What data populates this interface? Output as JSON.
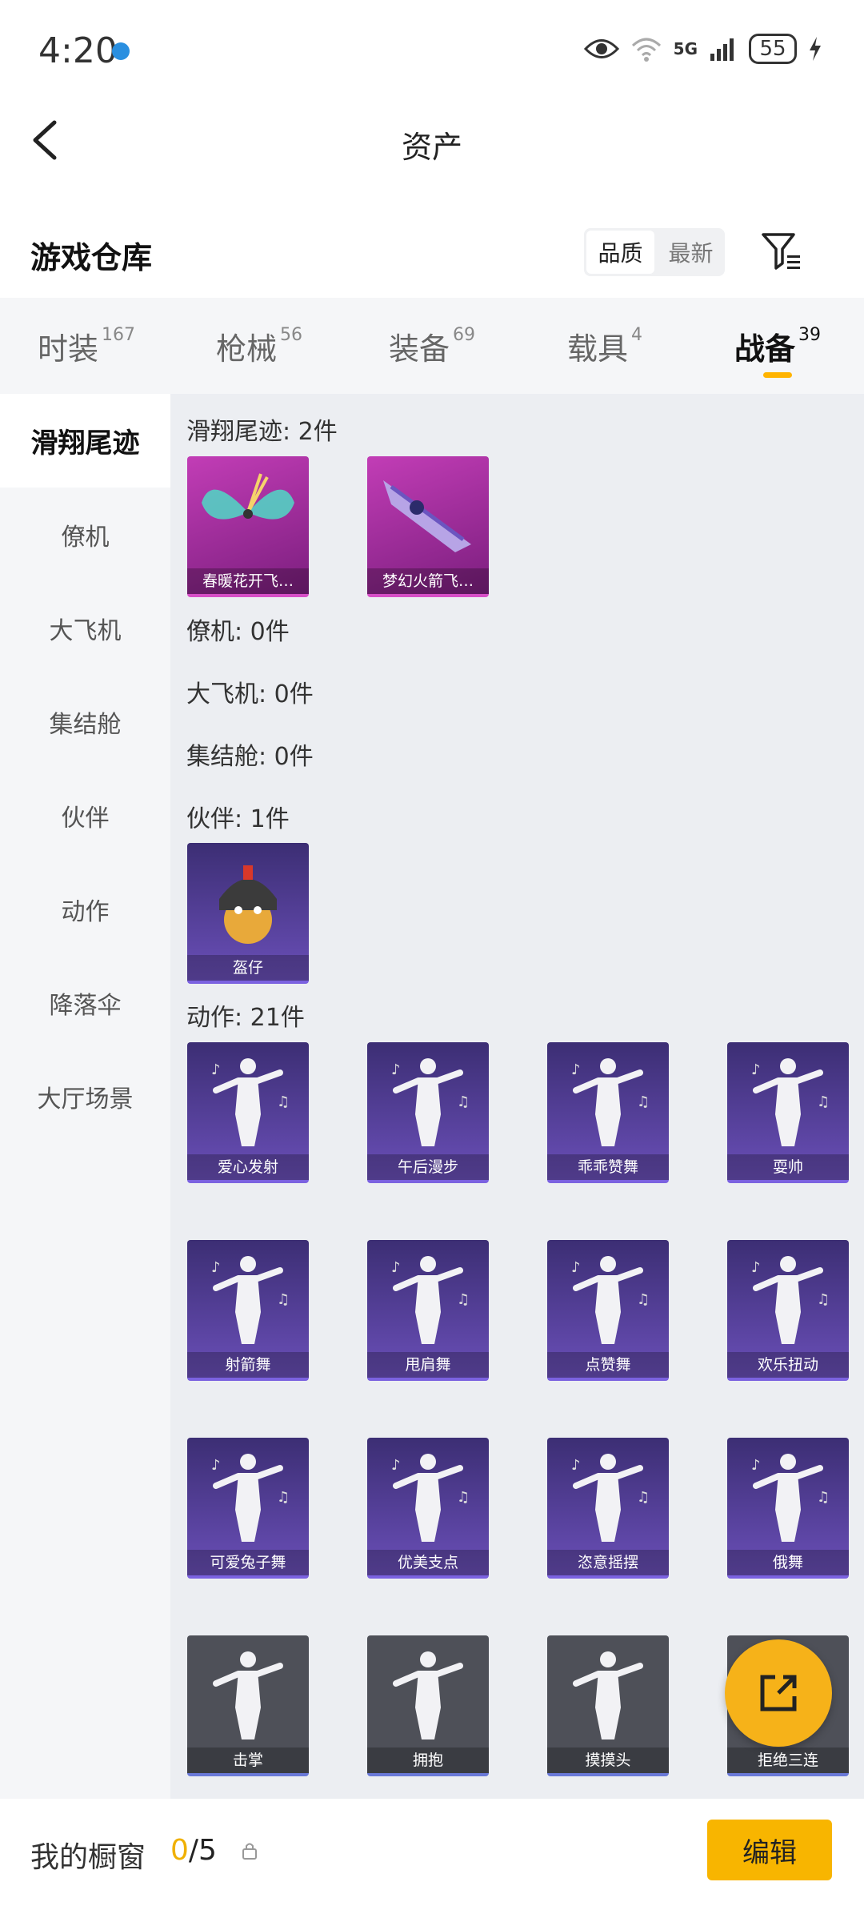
{
  "status": {
    "time": "4:20",
    "network": "5G",
    "battery": "55"
  },
  "header": {
    "title": "资产"
  },
  "section": {
    "title": "游戏仓库",
    "sort_options": [
      "品质",
      "最新"
    ],
    "sort_selected": "品质"
  },
  "tabs": [
    {
      "label": "时装",
      "count": "167"
    },
    {
      "label": "枪械",
      "count": "56"
    },
    {
      "label": "装备",
      "count": "69"
    },
    {
      "label": "载具",
      "count": "4"
    },
    {
      "label": "战备",
      "count": "39"
    }
  ],
  "active_tab": "战备",
  "sidebar": {
    "items": [
      "滑翔尾迹",
      "僚机",
      "大飞机",
      "集结舱",
      "伙伴",
      "动作",
      "降落伞",
      "大厅场景"
    ],
    "active": "滑翔尾迹"
  },
  "groups": {
    "glide": {
      "heading": "滑翔尾迹: 2件",
      "items": [
        "春暖花开飞…",
        "梦幻火箭飞…"
      ]
    },
    "wingman": {
      "heading": "僚机: 0件"
    },
    "plane": {
      "heading": "大飞机: 0件"
    },
    "capsule": {
      "heading": "集结舱: 0件"
    },
    "partner": {
      "heading": "伙伴: 1件",
      "items": [
        "盔仔"
      ]
    },
    "emote": {
      "heading": "动作: 21件",
      "items": [
        "爱心发射",
        "午后漫步",
        "乖乖赞舞",
        "耍帅",
        "射箭舞",
        "甩肩舞",
        "点赞舞",
        "欢乐扭动",
        "可爱兔子舞",
        "优美支点",
        "恣意摇摆",
        "俄舞",
        "击掌",
        "拥抱",
        "摸摸头",
        "拒绝三连"
      ]
    }
  },
  "bottom": {
    "label": "我的橱窗",
    "current": "0",
    "total": "/5",
    "edit": "编辑"
  },
  "colors": {
    "accent": "#f8b500",
    "pink_card": "#c23db6",
    "purple_card": "#5a43a0",
    "gray_card": "#4e5058"
  }
}
